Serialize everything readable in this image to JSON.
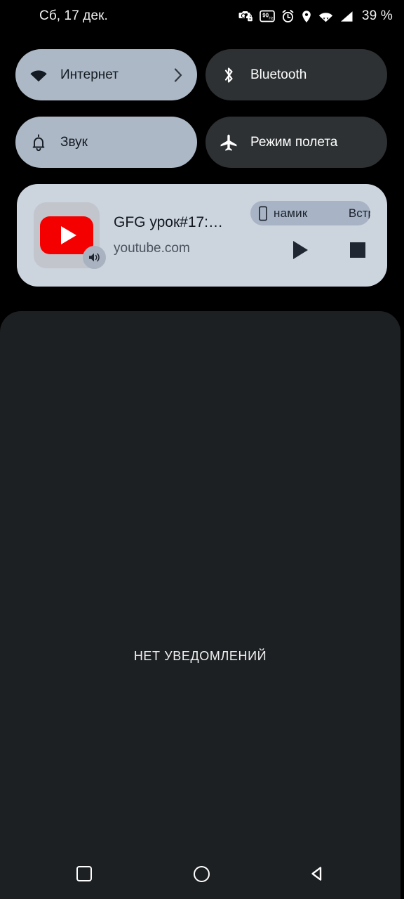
{
  "statusbar": {
    "date": "Сб, 17 дек.",
    "battery": "39 %",
    "icons": [
      "camera-lock-icon",
      "refresh-rate-90hz-icon",
      "alarm-icon",
      "location-pin-icon",
      "wifi-icon",
      "cellular-signal-icon"
    ]
  },
  "quick_settings": {
    "tiles": [
      {
        "id": "internet",
        "label": "Интернет",
        "icon": "wifi-icon",
        "state": "on",
        "chevron": true
      },
      {
        "id": "bluetooth",
        "label": "Bluetooth",
        "icon": "bluetooth-icon",
        "state": "off",
        "chevron": false
      },
      {
        "id": "sound",
        "label": "Звук",
        "icon": "bell-icon",
        "state": "on",
        "chevron": false
      },
      {
        "id": "airplane",
        "label": "Режим полета",
        "icon": "airplane-icon",
        "state": "off",
        "chevron": false
      }
    ],
    "colors": {
      "active_bg": "#adb8c6",
      "active_fg": "#11161d",
      "inactive_bg": "#2e3133",
      "inactive_fg": "#ffffff"
    }
  },
  "media": {
    "app_icon": "youtube-icon",
    "volume_badge_icon": "volume-up-icon",
    "title": "GFG урок#17:…",
    "subtitle": "youtube.com",
    "output_chip": {
      "icon": "phone-speaker-icon",
      "text": "намик",
      "text_clipped": "Встр"
    },
    "controls": [
      {
        "id": "play",
        "icon": "play-icon"
      },
      {
        "id": "stop",
        "icon": "stop-icon"
      }
    ],
    "colors": {
      "card_bg": "#ccd4de",
      "chip_bg": "#a8b4c5",
      "control_fg": "#1e2732",
      "youtube_red": "#f40000"
    }
  },
  "shade": {
    "empty_text": "НЕТ УВЕДОМЛЕНИЙ",
    "bg": "#1d2023"
  },
  "navbar": {
    "buttons": [
      {
        "id": "recents",
        "icon": "square-outline-icon"
      },
      {
        "id": "home",
        "icon": "circle-outline-icon"
      },
      {
        "id": "back",
        "icon": "triangle-left-icon"
      }
    ]
  }
}
